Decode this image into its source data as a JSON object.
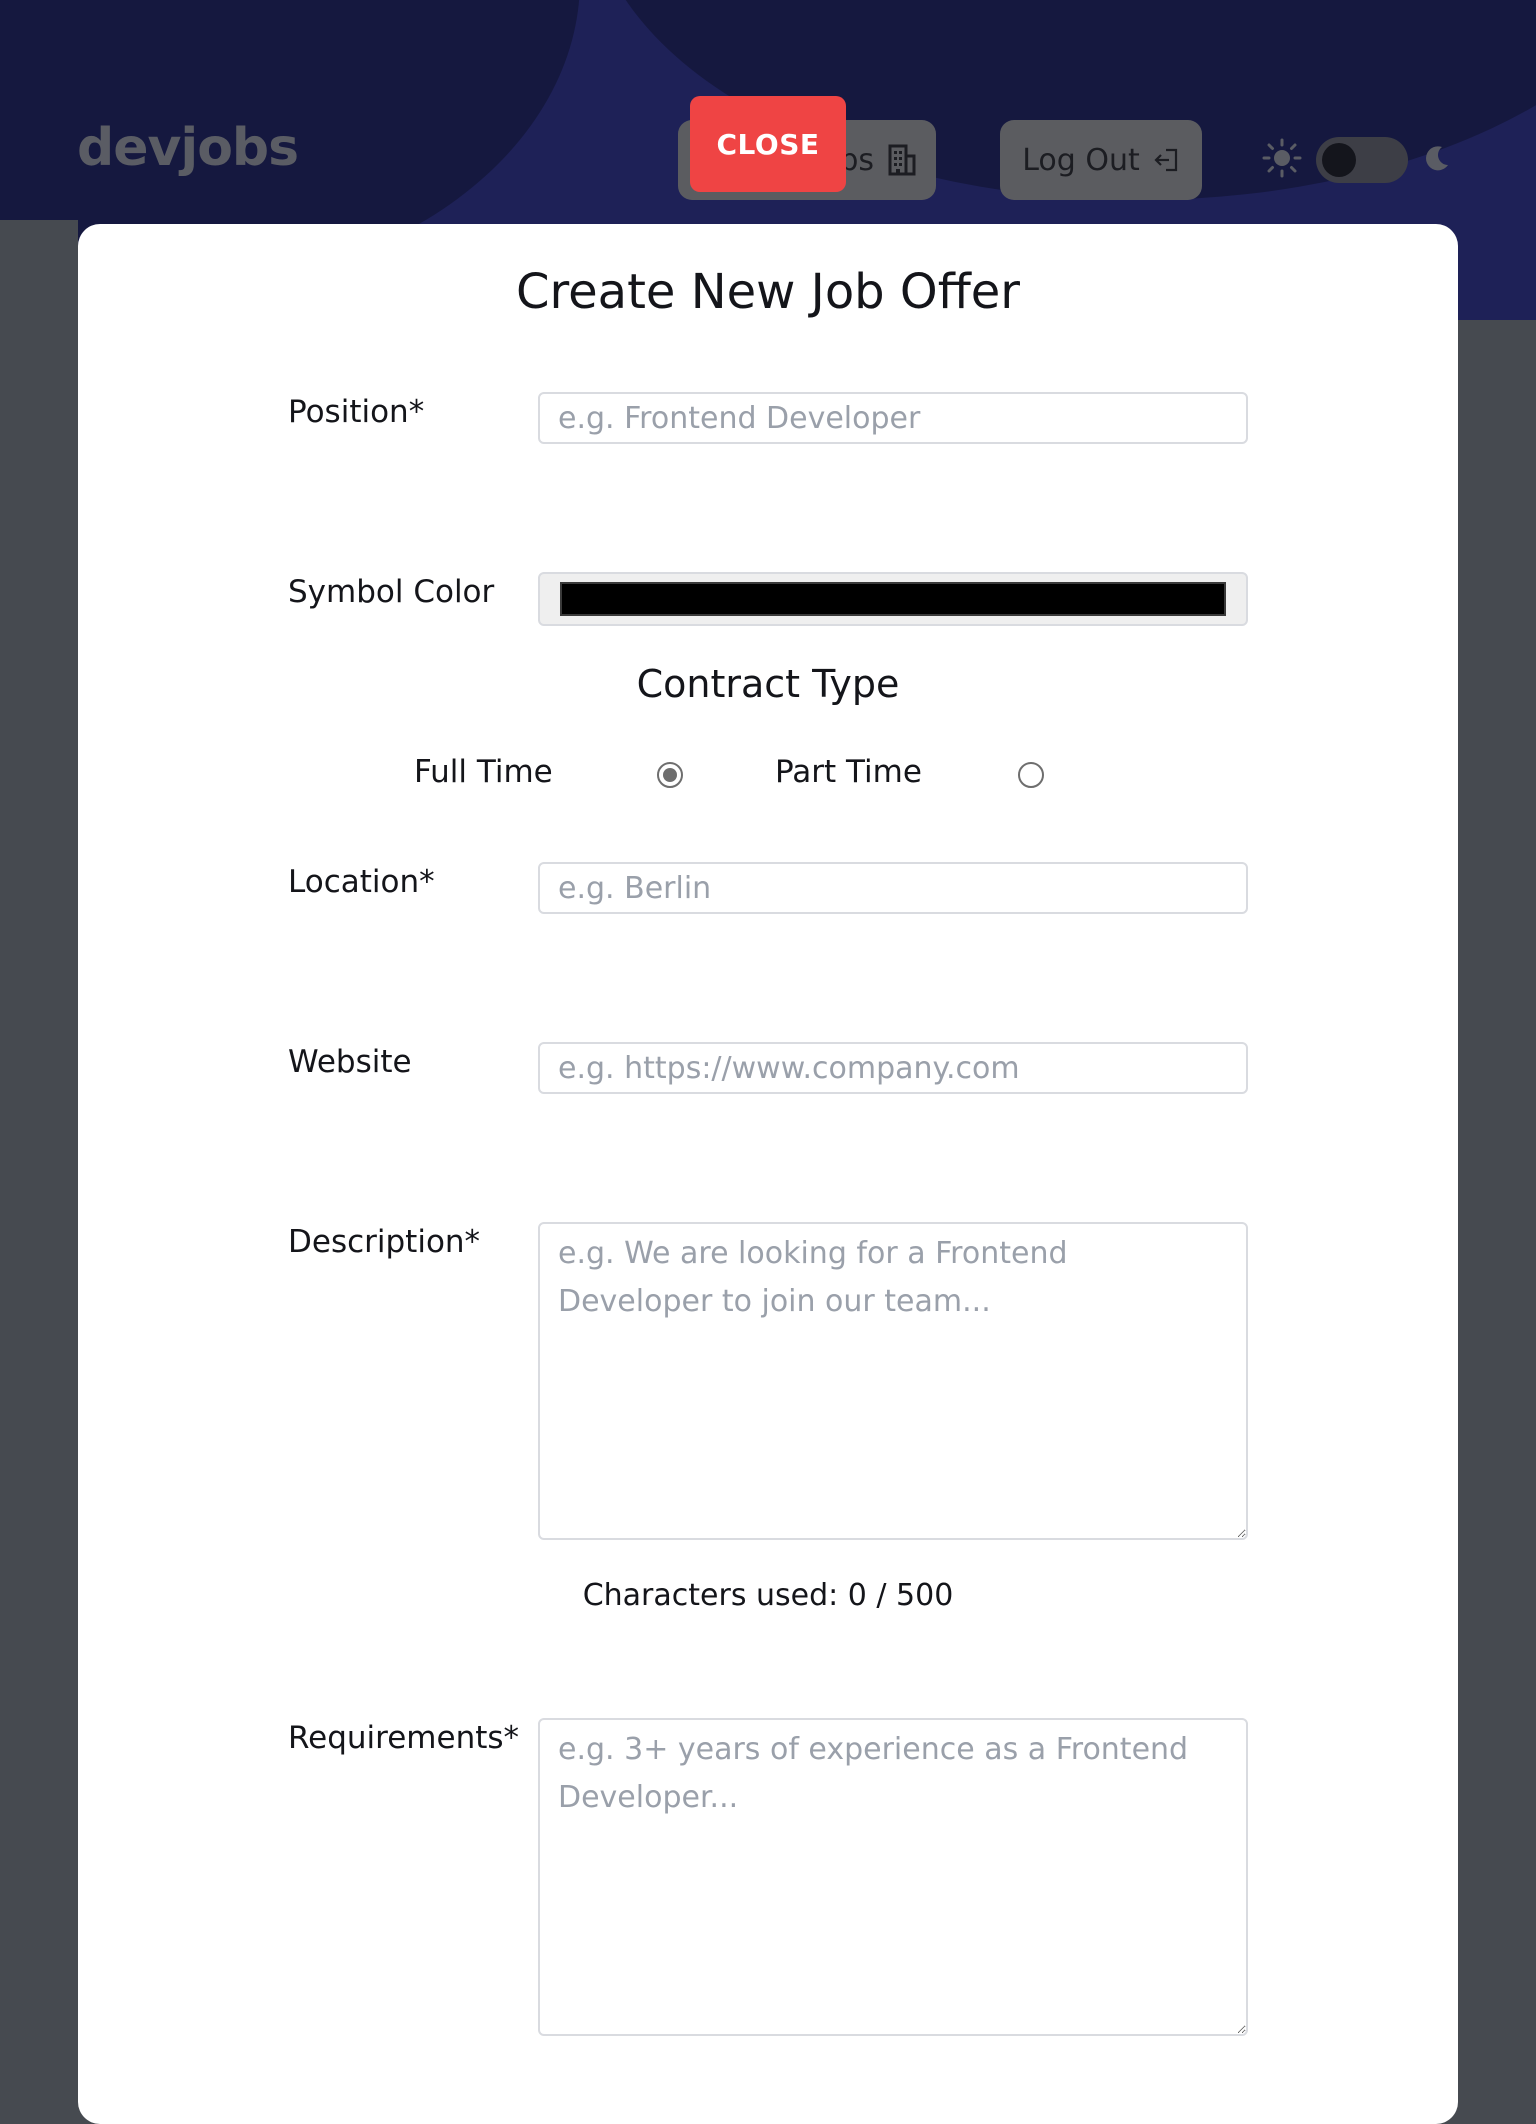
{
  "header": {
    "logo": "devjobs",
    "jobs_button_label": "Jobs",
    "logout_button_label": "Log Out",
    "close_button_label": "CLOSE",
    "icons": {
      "jobs": "building-icon",
      "logout": "logout-icon",
      "light": "sun-icon",
      "dark": "moon-icon"
    }
  },
  "theme_toggle": {
    "state": "light"
  },
  "modal": {
    "title": "Create New Job Offer",
    "fields": {
      "position": {
        "label": "Position*",
        "placeholder": "e.g. Frontend Developer",
        "value": ""
      },
      "symbol_color": {
        "label": "Symbol Color",
        "value": "#000000"
      },
      "contract_type": {
        "title": "Contract Type",
        "options": [
          {
            "label": "Full Time",
            "checked": true
          },
          {
            "label": "Part Time",
            "checked": false
          }
        ]
      },
      "location": {
        "label": "Location*",
        "placeholder": "e.g. Berlin",
        "value": ""
      },
      "website": {
        "label": "Website",
        "placeholder": "e.g. https://www.company.com",
        "value": ""
      },
      "description": {
        "label": "Description*",
        "placeholder": "e.g. We are looking for a Frontend Developer to join our team...",
        "value": "",
        "char_count_text": "Characters used: 0 / 500"
      },
      "requirements": {
        "label": "Requirements*",
        "placeholder": "e.g. 3+ years of experience as a Frontend Developer...",
        "value": ""
      }
    }
  },
  "colors": {
    "header_bg": "#1e2157",
    "overlay": "#464a50",
    "close_button": "#ef4444",
    "modal_bg": "#ffffff"
  }
}
